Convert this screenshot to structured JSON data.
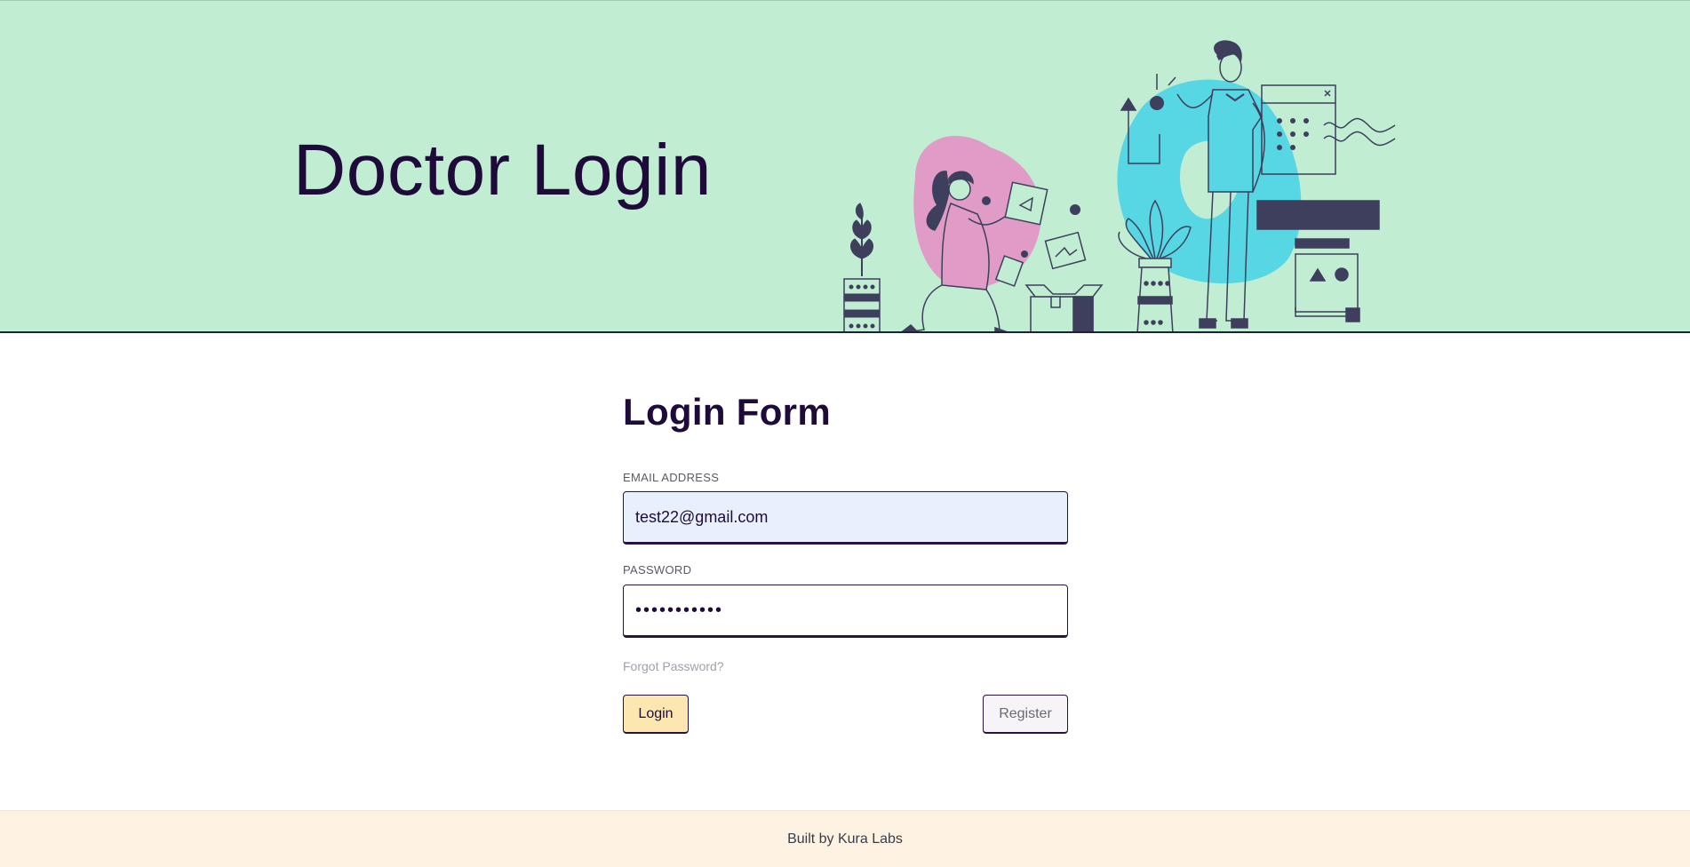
{
  "hero": {
    "title": "Doctor Login",
    "colors": {
      "background": "#c1edd3",
      "title": "#1e0b3a",
      "pink": "#e09cc6",
      "cyan": "#57d6e3",
      "ink": "#3d3f5c"
    },
    "illustration_icons": [
      "plant-icon",
      "woman-icon",
      "photo-frame-icon",
      "box-icon",
      "man-icon",
      "window-icon"
    ]
  },
  "form": {
    "title": "Login Form",
    "email": {
      "label": "EMAIL ADDRESS",
      "value": "test22@gmail.com"
    },
    "password": {
      "label": "PASSWORD",
      "value": "•••••••••••"
    },
    "forgot_link": "Forgot Password?",
    "login_button": "Login",
    "register_button": "Register",
    "colors": {
      "login_bg": "#fde7b0",
      "register_bg": "#f6f4f6",
      "email_bg": "#e8f0fe"
    }
  },
  "footer": {
    "text": "Built by Kura Labs"
  }
}
